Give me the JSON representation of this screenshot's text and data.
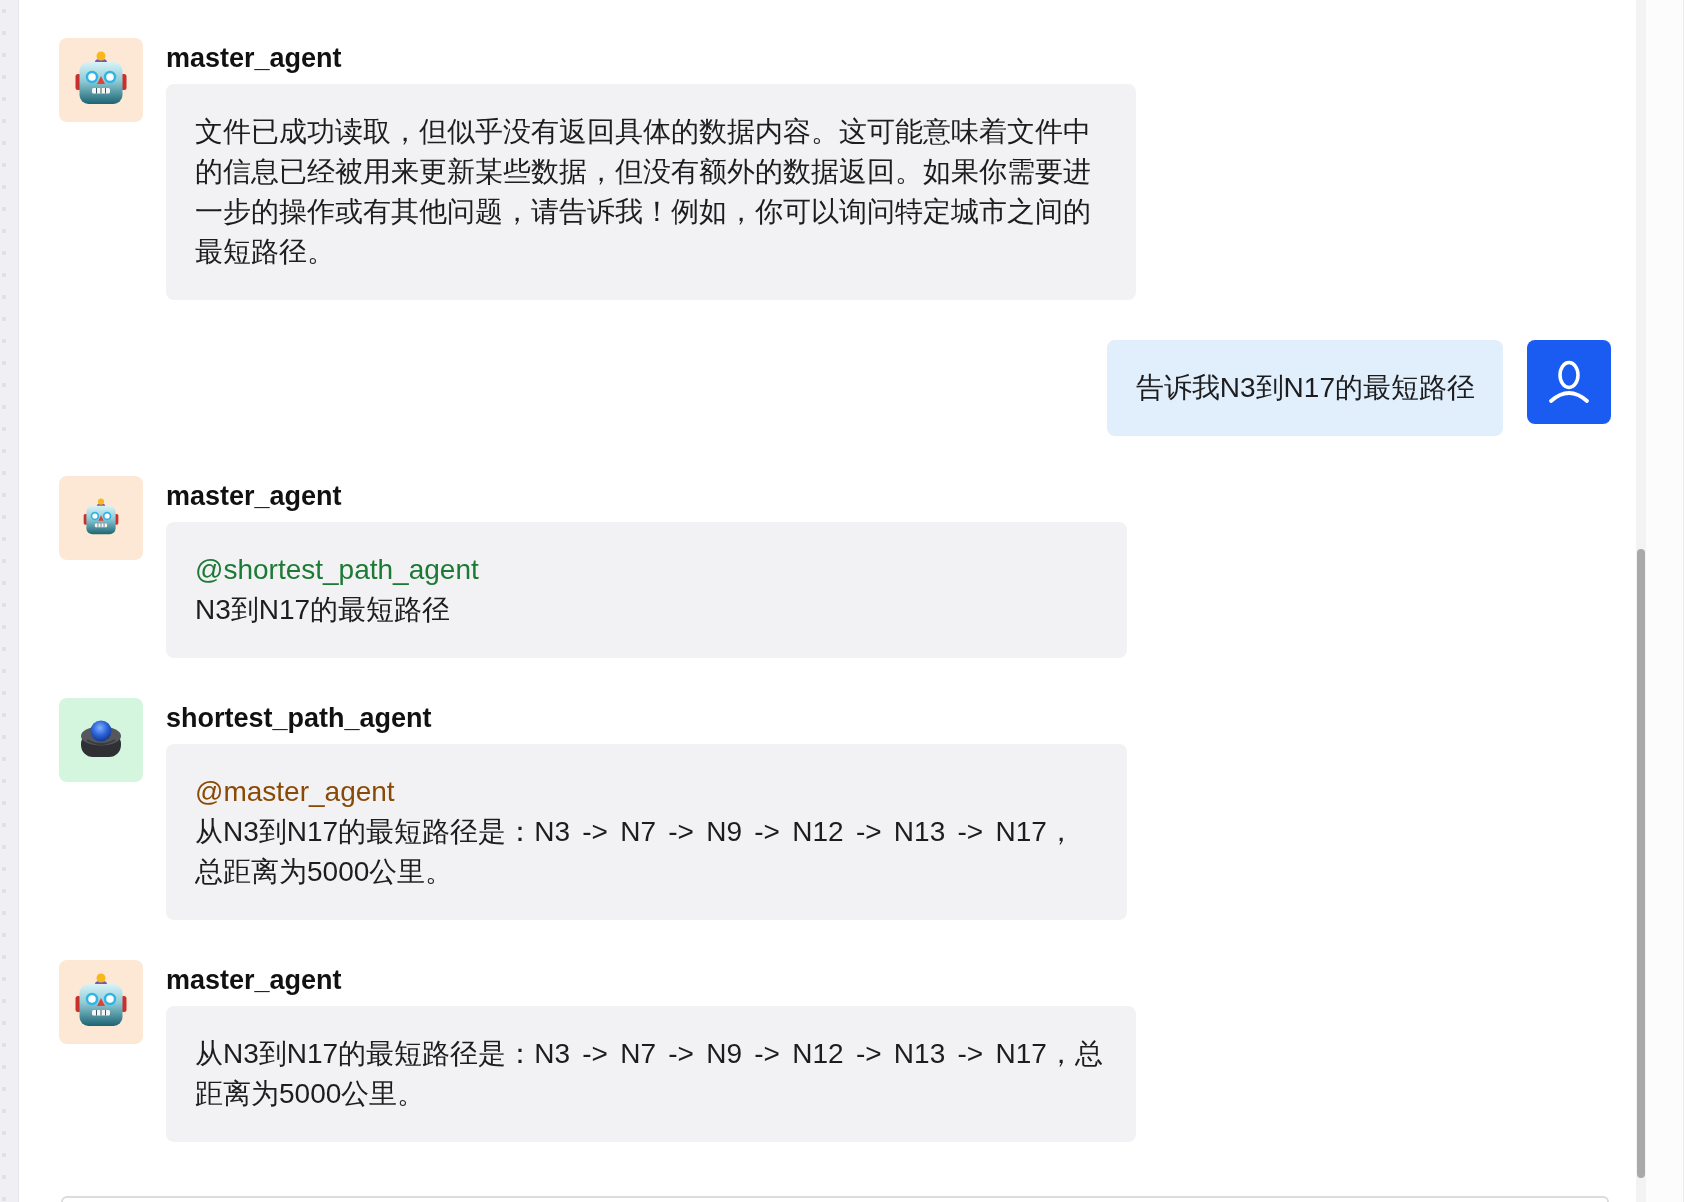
{
  "messages": [
    {
      "kind": "agent",
      "sender": "master_agent",
      "avatar": {
        "kind": "robot",
        "small": false,
        "color": "#fde8d6"
      },
      "text": "文件已成功读取，但似乎没有返回具体的数据内容。这可能意味着文件中的信息已经被用来更新某些数据，但没有额外的数据返回。如果你需要进一步的操作或有其他问题，请告诉我！例如，你可以询问特定城市之间的最短路径。"
    },
    {
      "kind": "user",
      "avatar": {
        "kind": "person",
        "color": "#1a5cf2"
      },
      "text": "告诉我N3到N17的最短路径"
    },
    {
      "kind": "agent",
      "sender": "master_agent",
      "avatar": {
        "kind": "robot",
        "small": true,
        "color": "#fde8d6"
      },
      "mention": {
        "text": "@shortest_path_agent",
        "color": "#1c7a35"
      },
      "text": "N3到N17的最短路径"
    },
    {
      "kind": "agent",
      "sender": "shortest_path_agent",
      "avatar": {
        "kind": "trackball",
        "small": false,
        "color": "#d4f5de"
      },
      "mention": {
        "text": "@master_agent",
        "color": "#8a4a06"
      },
      "text": "从N3到N17的最短路径是：N3 -> N7 -> N9 -> N12 -> N13 -> N17，总距离为5000公里。"
    },
    {
      "kind": "agent",
      "sender": "master_agent",
      "avatar": {
        "kind": "robot",
        "small": false,
        "color": "#fde8d6"
      },
      "text": "从N3到N17的最短路径是：N3 -> N7 -> N9 -> N12 -> N13 -> N17，总距离为5000公里。"
    }
  ]
}
